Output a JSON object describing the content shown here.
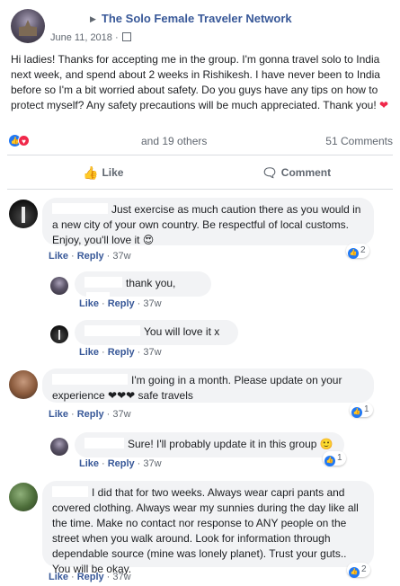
{
  "post": {
    "group_name": "The Solo Female Traveler Network",
    "caret": "▶",
    "date": "June 11, 2018 ·",
    "text": "Hi ladies! Thanks for accepting me in the group. I'm gonna travel solo to India next week, and spend about 2 weeks in Rishikesh. I have never been to India before so I'm a bit worried about safety. Do you guys have any tips on how to protect myself? Any safety precautions will be much appreciated. Thank you!",
    "heart": "❤"
  },
  "reactions": {
    "like_glyph": "👍",
    "love_glyph": "♥",
    "others": "and 19 others",
    "comments_count": "51 Comments"
  },
  "actions": {
    "like_label": "Like",
    "comment_label": "Comment",
    "like_icon": "👍",
    "comment_icon": "🗨"
  },
  "comment_actions": {
    "like": "Like",
    "reply": "Reply",
    "dot": "·"
  },
  "comments": [
    {
      "text": "Just exercise as much caution there as you would in a new city of your own country. Be respectful of local customs. Enjoy, you'll love it 😍",
      "time": "37w",
      "likes": "2"
    },
    {
      "text": "thank you,",
      "time": "37w"
    },
    {
      "text": "You will love it x",
      "time": "37w"
    },
    {
      "text": "I'm going in a month. Please update on your experience ❤❤❤ safe travels",
      "time": "37w",
      "likes": "1"
    },
    {
      "text": "Sure! I'll probably update it in this group 🙂",
      "time": "37w",
      "likes": "1"
    },
    {
      "text": "I did that for two weeks. Always wear capri pants and covered clothing. Always wear my sunnies during the day like all the time. Make no contact nor response to ANY people on the street when you walk around. Look for information through dependable source (mine was lonely planet). Trust your guts.. You will be okay.",
      "time": "37w",
      "likes": "2"
    }
  ],
  "colors": {
    "link_blue": "#385898",
    "like_blue": "#2078f4",
    "love_red": "#f0284a",
    "bubble_gray": "#f2f3f5"
  }
}
